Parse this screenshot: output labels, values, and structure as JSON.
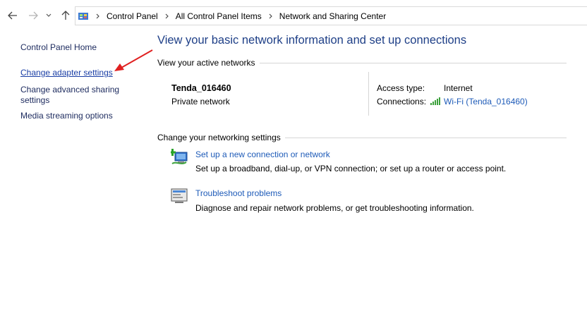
{
  "address_bar": {
    "breadcrumbs": [
      "Control Panel",
      "All Control Panel Items",
      "Network and Sharing Center"
    ]
  },
  "left_pane": {
    "home": "Control Panel Home",
    "change_adapter": "Change adapter settings",
    "advanced_sharing_line1": "Change advanced sharing",
    "advanced_sharing_line2": "settings",
    "media_streaming": "Media streaming options"
  },
  "main": {
    "title": "View your basic network information and set up connections",
    "active_networks_heading": "View your active networks",
    "network": {
      "name": "Tenda_016460",
      "category": "Private network",
      "access_type_label": "Access type:",
      "access_type_value": "Internet",
      "connections_label": "Connections:",
      "connections_value": "Wi-Fi (Tenda_016460)"
    },
    "settings_heading": "Change your networking settings",
    "tasks": [
      {
        "icon": "new-connection-icon",
        "link": "Set up a new connection or network",
        "desc": "Set up a broadband, dial-up, or VPN connection; or set up a router or access point."
      },
      {
        "icon": "troubleshoot-icon",
        "link": "Troubleshoot problems",
        "desc": "Diagnose and repair network problems, or get troubleshooting information."
      }
    ]
  },
  "colors": {
    "link_blue": "#1e5bb8",
    "title_blue": "#1e3f87",
    "annotation_red": "#e02020"
  }
}
